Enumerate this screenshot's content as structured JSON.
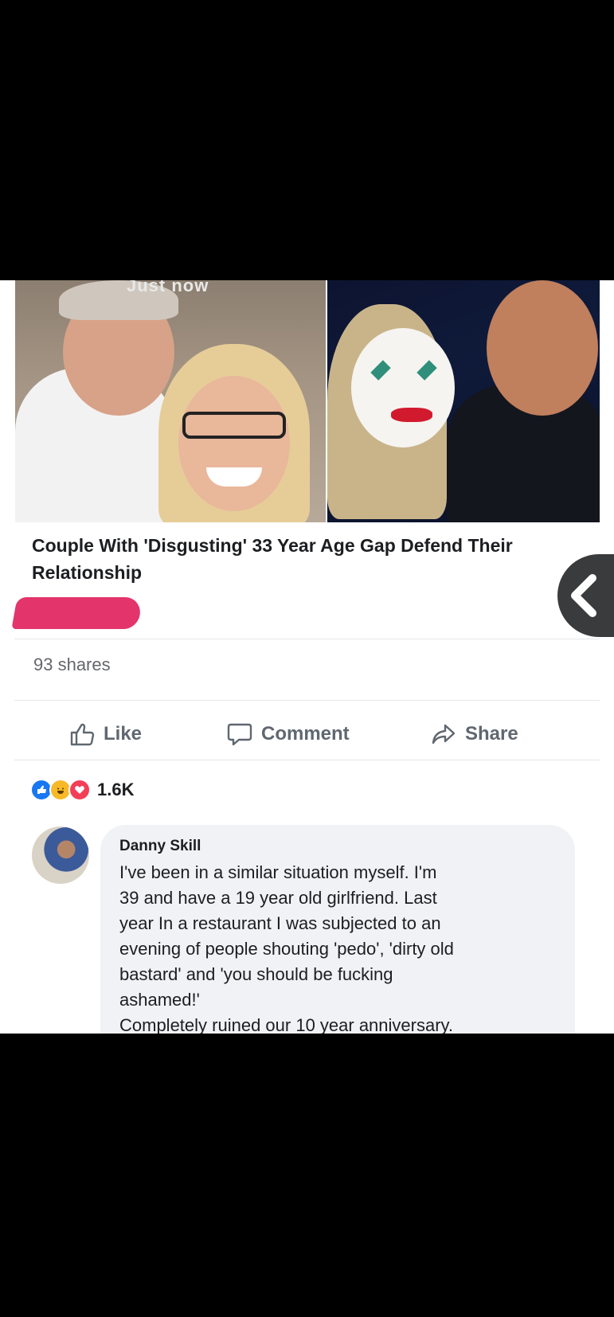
{
  "post": {
    "overlay_text": "Just now",
    "title": "Couple With 'Disgusting' 33 Year Age Gap Defend Their Relationship",
    "shares": "93 shares"
  },
  "actions": {
    "like": "Like",
    "comment": "Comment",
    "share": "Share"
  },
  "reactions": {
    "icons": [
      "like-icon",
      "haha-icon",
      "love-icon"
    ],
    "count": "1.6K",
    "colors": {
      "like": "#1877f2",
      "haha": "#f7b928",
      "love": "#f33e58"
    }
  },
  "comment": {
    "author": "Danny Skill",
    "text": "I've been in a similar situation  myself. I'm\n39 and have a 19 year old girlfriend. Last\nyear In a restaurant I was subjected to an\nevening of people shouting 'pedo', 'dirty old\nbastard' and 'you should be fucking\nashamed!'\nCompletely ruined our 10 year anniversary."
  },
  "colors": {
    "text_primary": "#1c1e21",
    "text_secondary": "#65676b",
    "redaction": "#e3356b",
    "bubble": "#f0f2f5"
  }
}
